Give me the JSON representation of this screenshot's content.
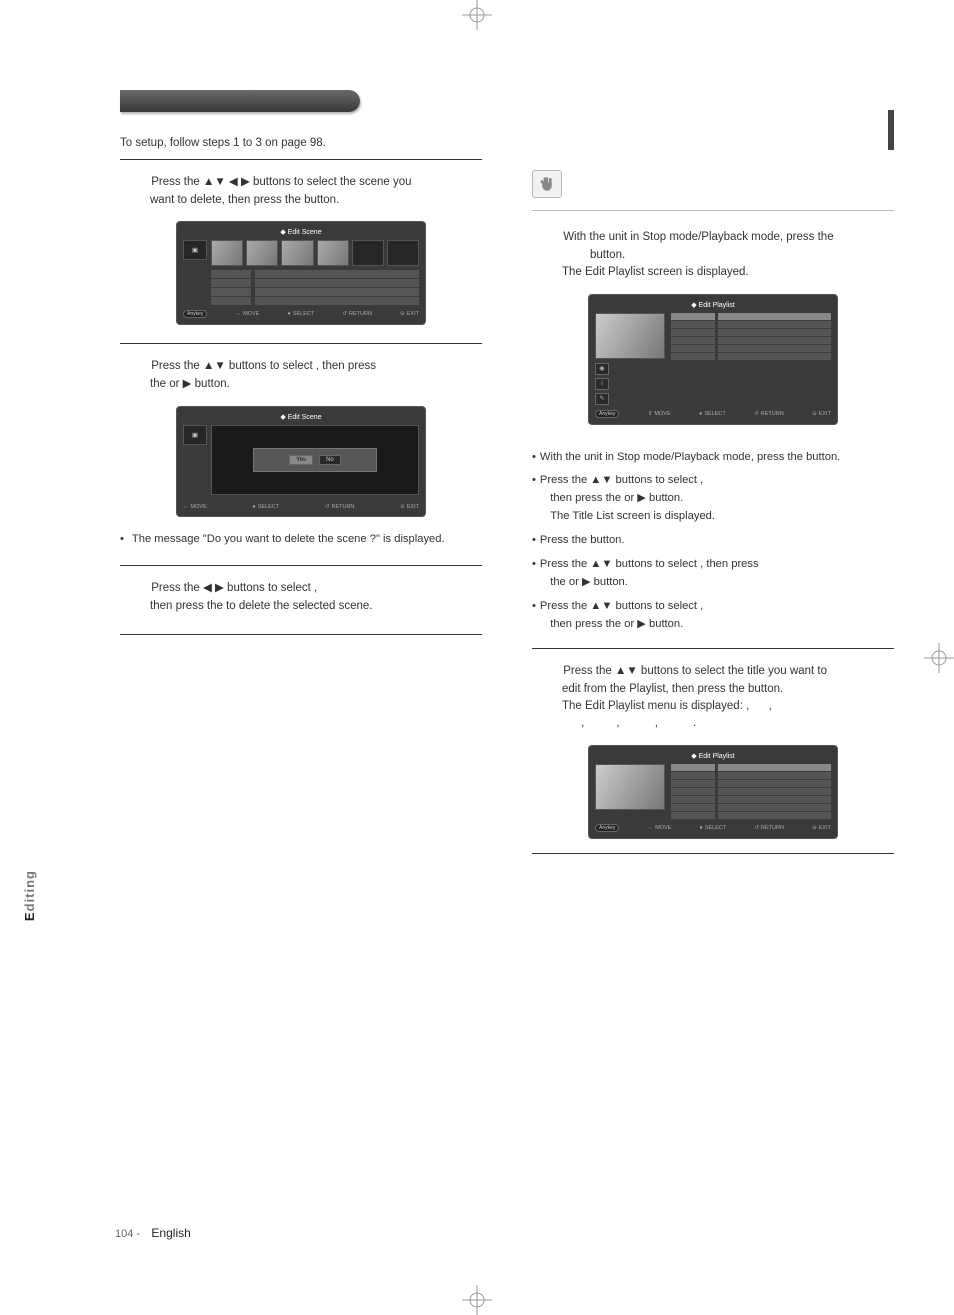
{
  "page_number": "104 -",
  "page_language": "English",
  "side_tab": "Editing",
  "left": {
    "setup_line": "To setup, follow steps 1 to 3 on page 98.",
    "step4_a": "Press the ▲▼ ◀ ▶ buttons to select the scene you",
    "step4_b": "want to delete, then press the",
    "step4_c": "button.",
    "ss1_title": "Edit Scene",
    "ss1_footer": {
      "move": "MOVE",
      "select": "SELECT",
      "return": "RETURN",
      "exit": "EXIT"
    },
    "step5_a": "Press the ▲▼ buttons to select",
    "step5_b": ", then press",
    "step5_c": "the",
    "step5_d": "or ▶ button.",
    "ss2_title": "Edit Scene",
    "ss2_modal_yes": "Yes",
    "ss2_modal_no": "No",
    "ss2_footer": {
      "move": "MOVE",
      "select": "SELECT",
      "return": "RETURN",
      "exit": "EXIT"
    },
    "note5": "The message \"Do you want to delete the scene ?\" is displayed.",
    "step6_a": "Press the ◀ ▶ buttons to select",
    "step6_b": ",",
    "step6_c": "then press the",
    "step6_d": "to delete the selected scene."
  },
  "right": {
    "step1_a": "With the unit in Stop mode/Playback mode, press the",
    "step1_b": "button.",
    "step1_c": "The Edit Playlist screen is displayed.",
    "ss3_title": "Edit Playlist",
    "ss3_footer": {
      "move": "MOVE",
      "select": "SELECT",
      "return": "RETURN",
      "exit": "EXIT"
    },
    "bul1_a": "With the unit in Stop mode/Playback mode, press the",
    "bul1_b": "button.",
    "bul2_a": "Press the ▲▼ buttons to select",
    "bul2_b": ",",
    "bul2_c": "then press the",
    "bul2_d": "or ▶ button.",
    "bul2_e": "The Title List screen is displayed.",
    "bul3_a": "Press the",
    "bul3_b": "button.",
    "bul4_a": "Press the ▲▼ buttons to select",
    "bul4_b": ", then press",
    "bul4_c": "the",
    "bul4_d": "or ▶ button.",
    "bul5_a": "Press the ▲▼ buttons to select",
    "bul5_b": ",",
    "bul5_c": "then press the",
    "bul5_d": "or ▶ button.",
    "step2_a": "Press the ▲▼ buttons to select the title you want to",
    "step2_b": "edit from the Playlist, then press the",
    "step2_c": "button.",
    "step2_d": "The Edit Playlist menu is displayed:",
    "step2_e": ",",
    "step2_f": ",",
    "step2_g": ",",
    "step2_h": ",",
    "step2_i": ",",
    "step2_j": ".",
    "ss4_title": "Edit Playlist",
    "ss4_footer": {
      "move": "MOVE",
      "select": "SELECT",
      "return": "RETURN",
      "exit": "EXIT"
    }
  }
}
